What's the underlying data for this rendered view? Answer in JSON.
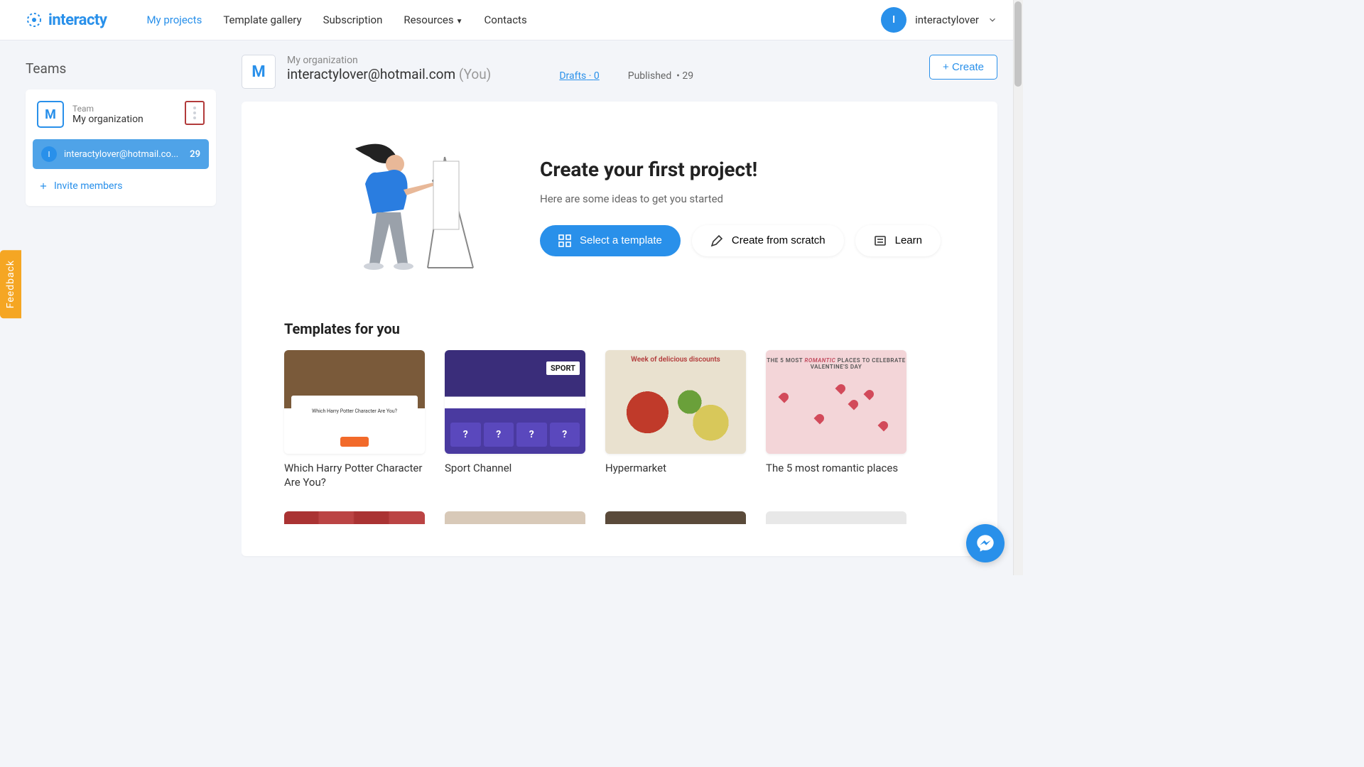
{
  "brand": "interacty",
  "nav": {
    "my_projects": "My projects",
    "template_gallery": "Template gallery",
    "subscription": "Subscription",
    "resources": "Resources",
    "contacts": "Contacts"
  },
  "user": {
    "initial": "I",
    "name": "interactylover"
  },
  "sidebar": {
    "teams_label": "Teams",
    "team": {
      "letter": "M",
      "tiny": "Team",
      "name": "My organization"
    },
    "member": {
      "initial": "I",
      "email": "interactylover@hotmail.co...",
      "count": "29"
    },
    "invite": "Invite members"
  },
  "header": {
    "letter": "M",
    "small": "My organization",
    "email": "interactylover@hotmail.com",
    "you": "(You)",
    "drafts_label": "Drafts",
    "drafts_count": "0",
    "published_label": "Published",
    "published_count": "29",
    "create": "+ Create"
  },
  "hero": {
    "title": "Create your first project!",
    "subtitle": "Here are some ideas to get you started",
    "select_template": "Select a template",
    "create_scratch": "Create from scratch",
    "learn": "Learn"
  },
  "templates": {
    "title": "Templates for you",
    "items": [
      {
        "title": "Which Harry Potter Character Are You?",
        "thumb_q": "Which Harry Potter Character Are You?"
      },
      {
        "title": "Sport Channel",
        "thumb_tag": "SPORT"
      },
      {
        "title": "Hypermarket",
        "thumb_head": "Week of delicious discounts"
      },
      {
        "title": "The 5 most romantic places",
        "thumb_head_a": "THE 5 MOST ",
        "thumb_head_b": "ROMANTIC",
        "thumb_head_c": " PLACES TO CELEBRATE VALENTINE'S DAY"
      }
    ]
  },
  "feedback": "Feedback"
}
